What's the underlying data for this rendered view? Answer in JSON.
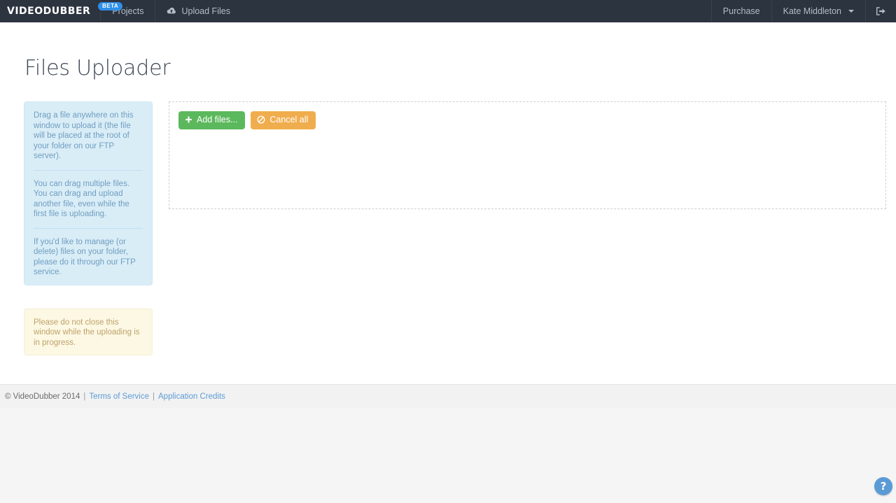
{
  "navbar": {
    "brand": {
      "text": "VIDEODUBBER",
      "badge": "BETA"
    },
    "left_items": [
      {
        "label": "Projects",
        "icon": ""
      },
      {
        "label": "Upload Files",
        "icon": "cloud-upload-icon"
      }
    ],
    "right_items": [
      {
        "label": "Purchase"
      },
      {
        "label": "Kate Middleton"
      }
    ],
    "logout_icon": "sign-out-icon",
    "background": "#2c3440",
    "text_color": "#b4bcc6",
    "badge_color": "#2f8fe8"
  },
  "page": {
    "title": "Files Uploader"
  },
  "info_panel": {
    "paragraphs": [
      "Drag a file anywhere on this window to upload it (the file will be placed at the root of your folder on our FTP server).",
      "You can drag multiple files. You can drag and upload another file, even while the first file is uploading.",
      "If you'd like to manage (or delete) files on your folder, please do it through our FTP service."
    ],
    "background": "#d9edf7",
    "text_color": "#6f9dc0"
  },
  "warning_panel": {
    "text": "Please do not close this window while the uploading is in progress.",
    "background": "#fcf8e3",
    "text_color": "#c0a16b"
  },
  "dropzone": {
    "add_files_label": "Add files...",
    "add_files_icon": "plus-icon",
    "add_files_color": "#5cb85c",
    "cancel_all_label": "Cancel all",
    "cancel_all_icon": "ban-icon",
    "cancel_all_color": "#f0ad4e",
    "border_color": "#cfcfcf"
  },
  "footer": {
    "copyright": "© VideoDubber 2014",
    "separator": "|",
    "terms_label": "Terms of Service",
    "credits_label": "Application Credits",
    "link_color": "#5b9bd5"
  },
  "help_button": {
    "glyph": "?",
    "color": "#5b9bd5"
  }
}
